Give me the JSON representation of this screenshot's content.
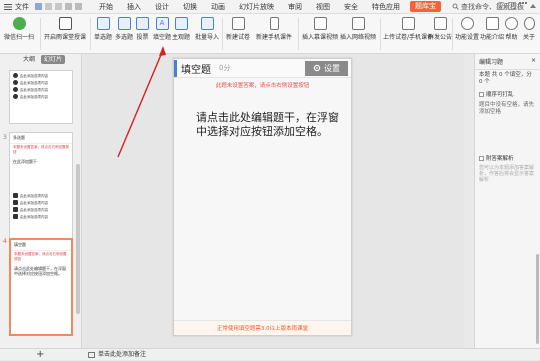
{
  "menu": {
    "file": "文件",
    "tabs": [
      "开始",
      "插入",
      "设计",
      "切换",
      "动画",
      "幻灯片放映",
      "审阅",
      "视图",
      "安全",
      "特色应用"
    ],
    "active_tab": "题库宝",
    "search": "查找命令、搜索模板"
  },
  "ribbon": {
    "wechat": "微信扫一扫",
    "open_class": "开启雨课堂授课",
    "single": "单选题",
    "multi": "多选题",
    "vote": "投票",
    "fill": "填空题",
    "subjective": "主观题",
    "batch": "批量导入",
    "new_paper": "新建试卷",
    "new_mobile": "新建手机课件",
    "insert_video": "插入慕课视频",
    "insert_web_video": "插入网络视频",
    "upload": "上传试卷/手机课件",
    "share": "群发公告",
    "func_settings": "功能设置",
    "func_intro": "功能介绍",
    "help": "帮助",
    "about": "关于"
  },
  "left": {
    "tab_outline": "大纲",
    "tab_slides": "幻灯片",
    "slides": [
      {
        "num": "",
        "items": [
          "由此添加选项内容",
          "由此添加选项内容",
          "由此添加选项内容",
          "由此添加选项内容"
        ]
      },
      {
        "num": "3",
        "header": "多选题",
        "warn": "本题未设置答案，请点击右侧设置按钮",
        "text": "在此添加题干",
        "items": [
          "由此添加选项内容",
          "由此添加选项内容",
          "由此添加选项内容",
          "由此添加选项内容"
        ]
      },
      {
        "num": "4",
        "header": "填空题",
        "warn": "本题未设置答案，请点击右侧设置按钮",
        "text": "请点击此处编辑题干，在浮窗中选择对应按钮添加空格。"
      }
    ]
  },
  "phone": {
    "title": "填空题",
    "count": "0分",
    "settings": "设置",
    "warn": "此题未设置答案，请点击右侧设置按钮",
    "main": "请点击此处编辑题干，在浮窗中选择对应按钮添加空格。",
    "bottom": "正常使用填空题需3.0以上版本雨课堂"
  },
  "right": {
    "header": "编辑习题",
    "line1": "本题 共 0 个填空，分 0 个",
    "check1": "顺序可打乱",
    "check1_note": "题目中没有空格，请先添加空格",
    "check2": "附答案解析",
    "hint": "您可以为本题添加答案解析，作答后将会显示答案解析"
  },
  "status": {
    "plus": "+",
    "note": "单击此处添加备注"
  },
  "colors": {
    "accent": "#f4623a",
    "warn": "#e05050",
    "arrow": "#d62020",
    "blue_bar": "#4a7fd4"
  }
}
